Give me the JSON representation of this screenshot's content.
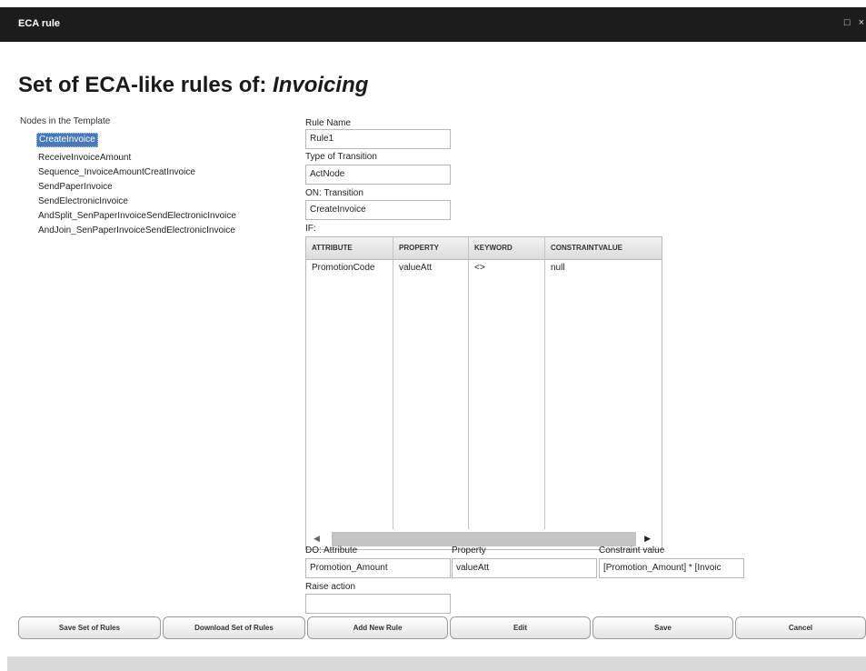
{
  "window": {
    "title": "ECA rule",
    "controls": {
      "maximize_icon": "maximize-icon",
      "close_icon": "close-icon",
      "maximize_glyph": "□",
      "close_glyph": "×"
    }
  },
  "heading": {
    "prefix": "Set of ECA-like rules of: ",
    "process": "Invoicing"
  },
  "nodes": {
    "label": "Nodes in the Template",
    "items": [
      "CreateInvoice",
      "ReceiveInvoiceAmount",
      "Sequence_InvoiceAmountCreatInvoice",
      "SendPaperInvoice",
      "SendElectronicInvoice",
      "AndSplit_SenPaperInvoiceSendElectronicInvoice",
      "AndJoin_SenPaperInvoiceSendElectronicInvoice"
    ],
    "selected_index": 0
  },
  "form": {
    "rule_name_label": "Rule Name",
    "rule_name_value": "Rule1",
    "transition_type_label": "Type of Transition",
    "transition_type_value": "ActNode",
    "on_transition_label": "ON: Transition",
    "on_transition_value": "CreateInvoice",
    "if_label": "IF:",
    "if_table": {
      "columns": [
        "ATTRIBUTE",
        "PROPERTY",
        "KEYWORD",
        "CONSTRAINTVALUE"
      ],
      "rows": [
        [
          "PromotionCode",
          "valueAtt",
          "<>",
          "null"
        ]
      ]
    },
    "do_attribute_label": "DO: Attribute",
    "do_attribute_value": "Promotion_Amount",
    "property_label": "Property",
    "property_value": "valueAtt",
    "constraint_label": "Constraint value",
    "constraint_value": "[Promotion_Amount] * [Invoic",
    "raise_action_label": "Raise action",
    "raise_action_value": ""
  },
  "buttons": {
    "save_set": "Save Set of Rules",
    "download_set": "Download Set of Rules",
    "add_rule": "Add New Rule",
    "edit": "Edit",
    "save": "Save",
    "cancel": "Cancel"
  },
  "scrollbar_glyphs": {
    "left": "◀",
    "right": "▶"
  }
}
